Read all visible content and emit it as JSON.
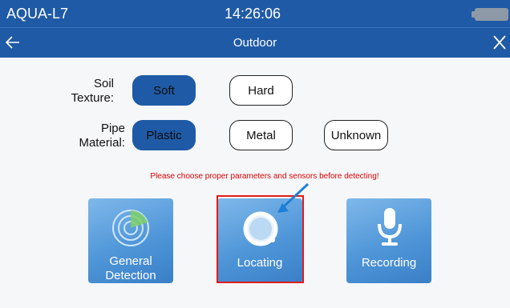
{
  "status": {
    "device": "AQUA-L7",
    "time": "14:26:06"
  },
  "titlebar": {
    "title": "Outdoor",
    "back_icon": "arrow-left-icon",
    "close_icon": "close-icon"
  },
  "soil": {
    "label_line1": "Soil",
    "label_line2": "Texture:",
    "options": [
      "Soft",
      "Hard"
    ],
    "selected": "Soft"
  },
  "pipe": {
    "label_line1": "Pipe",
    "label_line2": "Material:",
    "options": [
      "Plastic",
      "Metal",
      "Unknown"
    ],
    "selected": "Plastic"
  },
  "notice": "Please choose proper parameters and sensors before detecting!",
  "modes": [
    {
      "line1": "General",
      "line2": "Detection",
      "icon": "radar-icon"
    },
    {
      "line1": "Locating",
      "icon": "lens-icon"
    },
    {
      "line1": "Recording",
      "icon": "microphone-icon"
    }
  ],
  "colors": {
    "accent": "#1f5aa6",
    "tile": "#4f96d8",
    "highlight": "#e01b1b",
    "notice": "#dd0000"
  }
}
